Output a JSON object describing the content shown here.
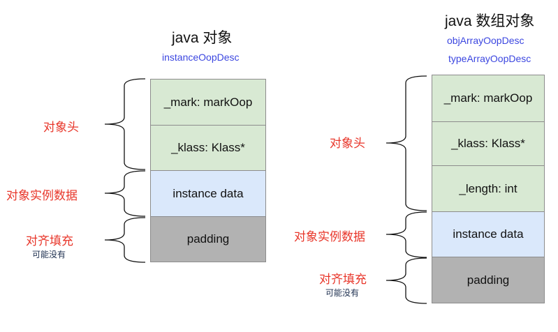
{
  "left": {
    "title": "java 对象",
    "subtitle": "instanceOopDesc",
    "cells": {
      "mark": "_mark: markOop",
      "klass": "_klass: Klass*",
      "instance": "instance data",
      "padding": "padding"
    },
    "labels": {
      "header": "对象头",
      "instance": "对象实例数据",
      "padding": "对齐填充",
      "padding_note": "可能没有"
    }
  },
  "right": {
    "title": "java 数组对象",
    "subtitle1": "objArrayOopDesc",
    "subtitle2": "typeArrayOopDesc",
    "cells": {
      "mark": "_mark: markOop",
      "klass": "_klass: Klass*",
      "length": "_length: int",
      "instance": "instance data",
      "padding": "padding"
    },
    "labels": {
      "header": "对象头",
      "instance": "对象实例数据",
      "padding": "对齐填充",
      "padding_note": "可能没有"
    }
  },
  "colors": {
    "header_cell": "#d8e9d3",
    "instance_cell": "#dae8fb",
    "padding_cell": "#b2b2b2",
    "label_red": "#e8362a",
    "subtitle_blue": "#3b46e0"
  }
}
